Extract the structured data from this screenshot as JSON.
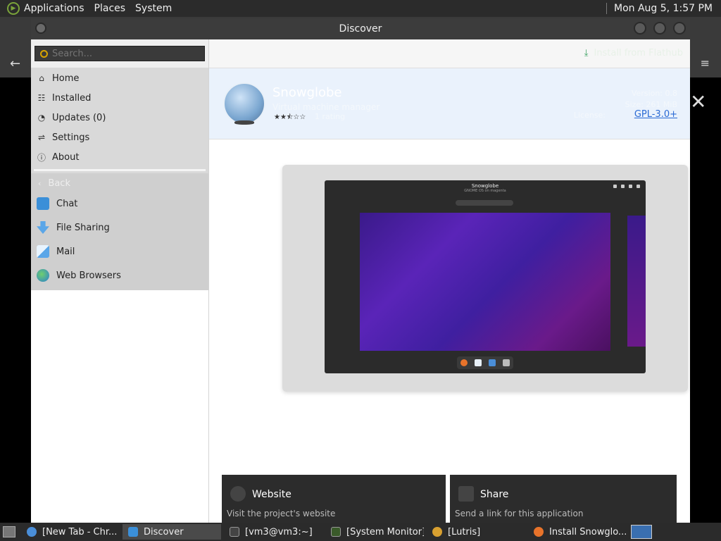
{
  "top_panel": {
    "menus": [
      "Applications",
      "Places",
      "System"
    ],
    "clock": "Mon Aug  5,  1:57 PM"
  },
  "window": {
    "title": "Discover"
  },
  "sidebar": {
    "search_placeholder": "Search...",
    "nav": [
      {
        "label": "Home",
        "icon": "home-icon"
      },
      {
        "label": "Installed",
        "icon": "installed-icon"
      },
      {
        "label": "Updates (0)",
        "icon": "updates-icon"
      },
      {
        "label": "Settings",
        "icon": "settings-icon"
      },
      {
        "label": "About",
        "icon": "about-icon"
      }
    ],
    "back_label": "Back",
    "categories": [
      {
        "label": "Chat",
        "icon": "chat-icon"
      },
      {
        "label": "File Sharing",
        "icon": "file-sharing-icon"
      },
      {
        "label": "Mail",
        "icon": "mail-icon"
      },
      {
        "label": "Web Browsers",
        "icon": "web-browsers-icon"
      }
    ]
  },
  "header": {
    "install_label": "Install from Flathub"
  },
  "app": {
    "name": "Snowglobe",
    "subtitle": "Virtual machine manager",
    "rating_stars": "★★⯪☆☆",
    "rating": 2.5,
    "reviews": "1 rating",
    "version": "Version: 0.8",
    "size": "Size: 261 MiB",
    "license_label": "License:",
    "license": "GPL-3.0+"
  },
  "screenshot": {
    "title": "Snowglobe",
    "subtitle": "GNOME OS on magenta"
  },
  "cards": [
    {
      "title": "Website",
      "desc": "Visit the project's website",
      "icon": "globe-icon"
    },
    {
      "title": "Share",
      "desc": "Send a link for this application",
      "icon": "share-icon"
    }
  ],
  "taskbar": {
    "tasks": [
      {
        "label": "[New Tab - Chr...",
        "icon": "chrome-icon",
        "active": false
      },
      {
        "label": "Discover",
        "icon": "discover-icon",
        "active": true
      },
      {
        "label": "[vm3@vm3:~]",
        "icon": "terminal-icon",
        "active": false
      },
      {
        "label": "[System Monitor]",
        "icon": "system-monitor-icon",
        "active": false
      },
      {
        "label": "[Lutris]",
        "icon": "lutris-icon",
        "active": false
      },
      {
        "label": "Install Snowglo...",
        "icon": "firefox-icon",
        "active": false
      }
    ]
  },
  "colors": {
    "accent": "#2a6ad4",
    "panel": "#2b2b2b",
    "app_header_bg": "#eaf2fc"
  }
}
